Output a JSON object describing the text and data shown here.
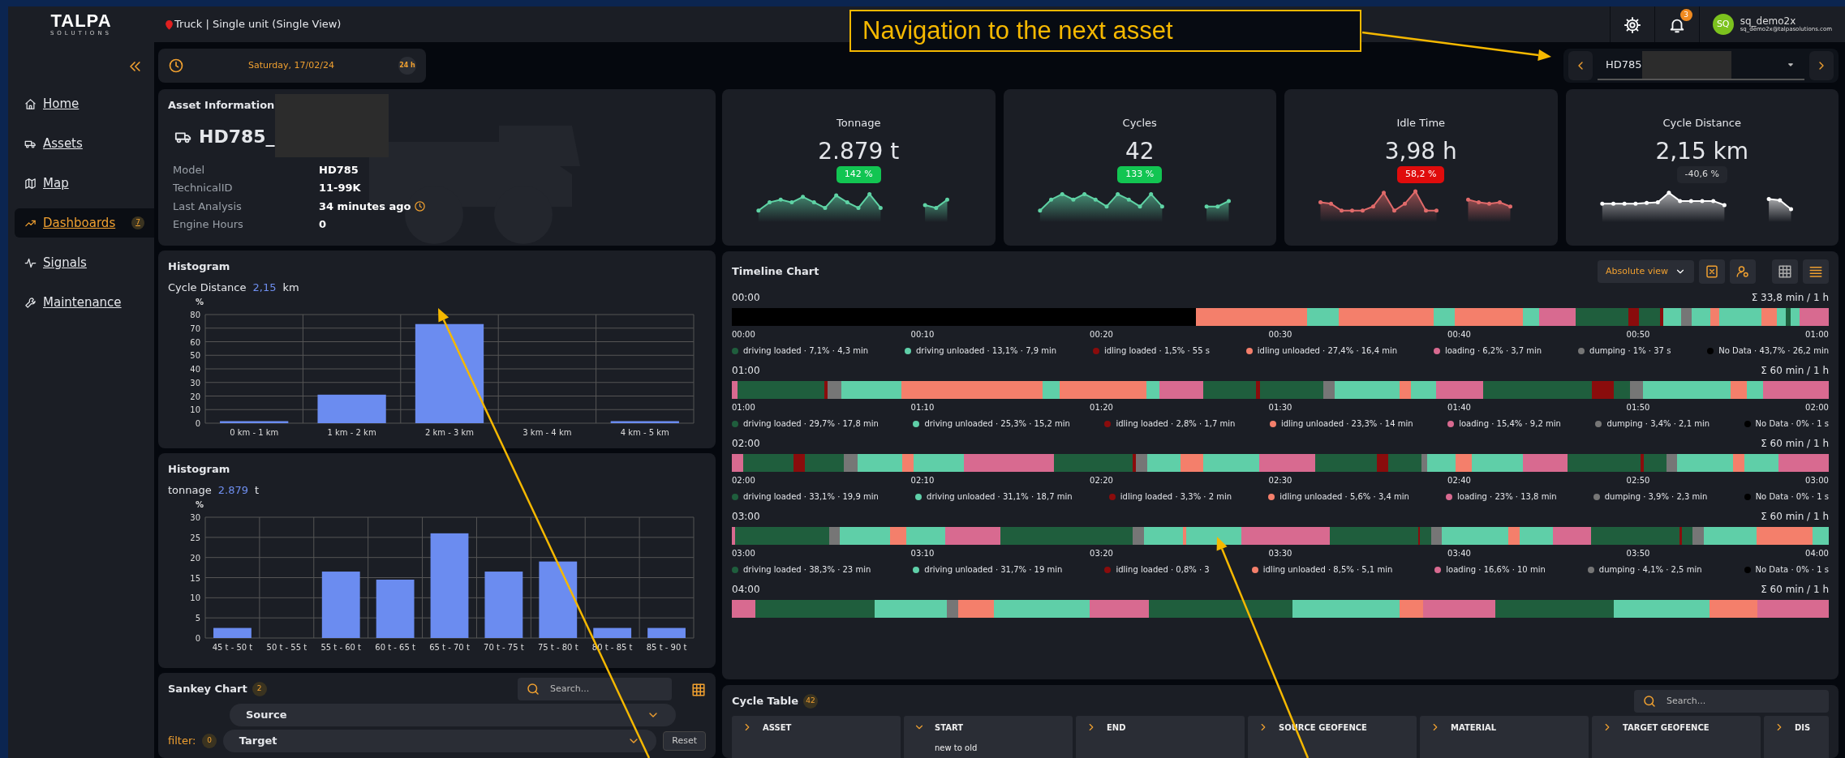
{
  "app": {
    "logo": "TALPA",
    "logo_sub": "SOLUTIONS",
    "breadcrumb": "Truck | Single unit (Single View)"
  },
  "user": {
    "initials": "SQ",
    "name": "sq_demo2x",
    "email": "sq_demo2x@talpasolutions.com",
    "notifications": "3"
  },
  "sidebar": {
    "items": [
      {
        "label": "Home",
        "kind": "home",
        "selected": false
      },
      {
        "label": "Assets",
        "kind": "assets",
        "selected": false
      },
      {
        "label": "Map",
        "kind": "map",
        "selected": false
      },
      {
        "label": "Dashboards",
        "kind": "dashboards",
        "selected": true,
        "badge": "7"
      },
      {
        "label": "Signals",
        "kind": "signals",
        "selected": false
      },
      {
        "label": "Maintenance",
        "kind": "maintenance",
        "selected": false
      }
    ]
  },
  "date_picker": {
    "date": "Saturday, 17/02/24",
    "range": "24 h"
  },
  "asset_nav": {
    "value": "HD785"
  },
  "asset_info": {
    "title": "Asset Information",
    "name": "HD785_",
    "fields": [
      {
        "label": "Model",
        "value": "HD785"
      },
      {
        "label": "TechnicalID",
        "value": "11-99K"
      },
      {
        "label": "Last Analysis",
        "value": "34 minutes ago",
        "kind": "time"
      },
      {
        "label": "Engine Hours",
        "value": "0"
      }
    ]
  },
  "kpis": [
    {
      "title": "Tonnage",
      "value": "2.879 t",
      "change": "142 %",
      "kind": "up"
    },
    {
      "title": "Cycles",
      "value": "42",
      "change": "133 %",
      "kind": "up"
    },
    {
      "title": "Idle Time",
      "value": "3,98 h",
      "change": "58,2 %",
      "kind": "down"
    },
    {
      "title": "Cycle Distance",
      "value": "2,15 km",
      "change": "-40,6 %",
      "kind": "neutral"
    }
  ],
  "histograms": [
    {
      "title": "Histogram",
      "metric": "Cycle Distance",
      "metric_value": "2,15",
      "unit": "km",
      "chart_data": {
        "type": "bar",
        "ylabel": "%",
        "categories": [
          "0 km - 1 km",
          "1 km - 2 km",
          "2 km - 3 km",
          "3 km - 4 km",
          "4 km - 5 km"
        ],
        "values": [
          1.5,
          21,
          73,
          0,
          1.5
        ],
        "grid": true,
        "ylim": [
          0,
          80
        ],
        "yticks": [
          0,
          10,
          20,
          30,
          40,
          50,
          60,
          70,
          80
        ]
      }
    },
    {
      "title": "Histogram",
      "metric": "tonnage",
      "metric_value": "2.879",
      "unit": "t",
      "chart_data": {
        "type": "bar",
        "ylabel": "%",
        "categories": [
          "45 t - 50 t",
          "50 t - 55 t",
          "55 t - 60 t",
          "60 t - 65 t",
          "65 t - 70 t",
          "70 t - 75 t",
          "75 t - 80 t",
          "80 t - 85 t",
          "85 t - 90 t"
        ],
        "values": [
          2.5,
          0,
          16.5,
          14.5,
          26,
          16.5,
          19,
          2.5,
          2.5
        ],
        "grid": true,
        "ylim": [
          0,
          30
        ],
        "yticks": [
          0,
          5,
          10,
          15,
          20,
          25,
          30
        ]
      }
    }
  ],
  "sankey": {
    "title": "Sankey Chart",
    "count": "2",
    "search_placeholder": "Search...",
    "source": "Source",
    "filter_label": "filter:",
    "filter_count": "0",
    "target": "Target",
    "reset": "Reset"
  },
  "timeline": {
    "title": "Timeline Chart",
    "view": "Absolute view",
    "layout_options": [
      {
        "kind": "grid",
        "selected": false
      },
      {
        "kind": "list",
        "selected": true
      }
    ],
    "rows": [
      {
        "start": "00:00",
        "total": "Σ 33,8 min / 1 h",
        "ticks": [
          "00:00",
          "00:10",
          "00:20",
          "00:30",
          "00:40",
          "00:50",
          "01:00"
        ],
        "legend": [
          {
            "label": "driving loaded · 7,1% · 4,3 min",
            "color": "#1f5e3d"
          },
          {
            "label": "driving unloaded · 13,1% · 7,9 min",
            "color": "#5fcfa8"
          },
          {
            "label": "idling loaded · 1,5% · 55 s",
            "color": "#8a0c0c"
          },
          {
            "label": "idling unloaded · 27,4% · 16,4 min",
            "color": "#f47f6b"
          },
          {
            "label": "loading · 6,2% · 3,7 min",
            "color": "#d86a90"
          },
          {
            "label": "dumping · 1% · 37 s",
            "color": "#767676"
          },
          {
            "label": "No Data · 43,7% · 26,2 min",
            "color": "#000000"
          }
        ]
      },
      {
        "start": "01:00",
        "total": "Σ 60 min / 1 h",
        "ticks": [
          "01:00",
          "01:10",
          "01:20",
          "01:30",
          "01:40",
          "01:50",
          "02:00"
        ],
        "legend": [
          {
            "label": "driving loaded · 29,7% · 17,8 min",
            "color": "#1f5e3d"
          },
          {
            "label": "driving unloaded · 25,3% · 15,2 min",
            "color": "#5fcfa8"
          },
          {
            "label": "idling loaded · 2,8% · 1,7 min",
            "color": "#8a0c0c"
          },
          {
            "label": "idling unloaded · 23,3% · 14 min",
            "color": "#f47f6b"
          },
          {
            "label": "loading · 15,4% · 9,2 min",
            "color": "#d86a90"
          },
          {
            "label": "dumping · 3,4% · 2,1 min",
            "color": "#767676"
          },
          {
            "label": "No Data · 0% · 1 s",
            "color": "#000000"
          }
        ]
      },
      {
        "start": "02:00",
        "total": "Σ 60 min / 1 h",
        "ticks": [
          "02:00",
          "02:10",
          "02:20",
          "02:30",
          "02:40",
          "02:50",
          "03:00"
        ],
        "legend": [
          {
            "label": "driving loaded · 33,1% · 19,9 min",
            "color": "#1f5e3d"
          },
          {
            "label": "driving unloaded · 31,1% · 18,7 min",
            "color": "#5fcfa8"
          },
          {
            "label": "idling loaded · 3,3% · 2 min",
            "color": "#8a0c0c"
          },
          {
            "label": "idling unloaded · 5,6% · 3,4 min",
            "color": "#f47f6b"
          },
          {
            "label": "loading · 23% · 13,8 min",
            "color": "#d86a90"
          },
          {
            "label": "dumping · 3,9% · 2,3 min",
            "color": "#767676"
          },
          {
            "label": "No Data · 0% · 1 s",
            "color": "#000000"
          }
        ]
      },
      {
        "start": "03:00",
        "total": "Σ 60 min / 1 h",
        "ticks": [
          "03:00",
          "03:10",
          "03:20",
          "03:30",
          "03:40",
          "03:50",
          "04:00"
        ],
        "legend": [
          {
            "label": "driving loaded · 38,3% · 23 min",
            "color": "#1f5e3d"
          },
          {
            "label": "driving unloaded · 31,7% · 19 min",
            "color": "#5fcfa8"
          },
          {
            "label": "idling loaded · 0,8% · 3",
            "color": "#8a0c0c"
          },
          {
            "label": "idling unloaded · 8,5% · 5,1 min",
            "color": "#f47f6b"
          },
          {
            "label": "loading · 16,6% · 10 min",
            "color": "#d86a90"
          },
          {
            "label": "dumping · 4,1% · 2,5 min",
            "color": "#767676"
          },
          {
            "label": "No Data · 0% · 1 s",
            "color": "#000000"
          }
        ]
      },
      {
        "start": "04:00",
        "total": "Σ 60 min / 1 h"
      }
    ]
  },
  "cycle_table": {
    "title": "Cycle Table",
    "count": "42",
    "search_placeholder": "Search...",
    "columns": [
      {
        "label": "ASSET",
        "sorted": false
      },
      {
        "label": "START",
        "sorted": true,
        "sort_note": "new to old"
      },
      {
        "label": "END",
        "sorted": false
      },
      {
        "label": "SOURCE GEOFENCE",
        "sorted": false
      },
      {
        "label": "MATERIAL",
        "sorted": false
      },
      {
        "label": "TARGET GEOFENCE",
        "sorted": false
      },
      {
        "label": "DIS",
        "sorted": false
      }
    ]
  },
  "annotation": {
    "callout": "Navigation to the next asset"
  }
}
